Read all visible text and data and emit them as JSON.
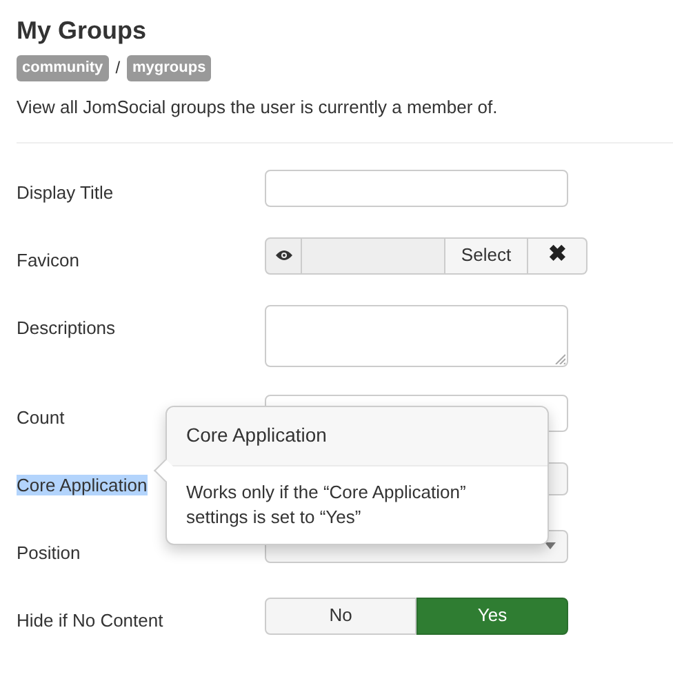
{
  "title": "My Groups",
  "breadcrumbs": [
    "community",
    "mygroups"
  ],
  "breadcrumb_separator": "/",
  "description": "View all JomSocial groups the user is currently a member of.",
  "fields": [
    {
      "label": "Display Title",
      "kind": "text",
      "highlighted": false
    },
    {
      "label": "Favicon",
      "kind": "media",
      "highlighted": false,
      "select_label": "Select",
      "clear_label": "✖"
    },
    {
      "label": "Descriptions",
      "kind": "textarea",
      "highlighted": false
    },
    {
      "label": "Count",
      "kind": "text",
      "highlighted": false
    },
    {
      "label": "Core Application",
      "kind": "hidden",
      "highlighted": true
    },
    {
      "label": "Position",
      "kind": "select",
      "highlighted": false
    },
    {
      "label": "Hide if No Content",
      "kind": "toggle",
      "highlighted": false,
      "options": [
        {
          "label": "No",
          "selected": false
        },
        {
          "label": "Yes",
          "selected": true
        }
      ]
    }
  ],
  "popover": {
    "title": "Core Application",
    "body": "Works only if the “Core Application” settings is set to “Yes”"
  }
}
